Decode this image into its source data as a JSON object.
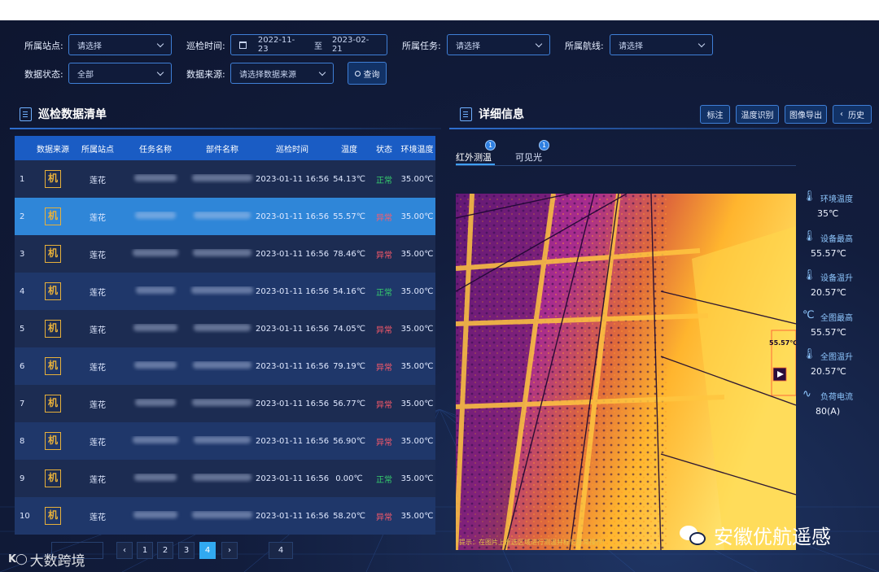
{
  "filters": {
    "station_label": "所属站点:",
    "station_value": "请选择",
    "time_label": "巡检时间:",
    "date_start": "2022-11-23",
    "date_sep": "至",
    "date_end": "2023-02-21",
    "task_label": "所属任务:",
    "task_value": "请选择",
    "route_label": "所属航线:",
    "route_value": "请选择",
    "status_label": "数据状态:",
    "status_value": "全部",
    "source_label": "数据来源:",
    "source_placeholder": "请选择数据来源",
    "query_button": "查询"
  },
  "list": {
    "title": "巡检数据清单",
    "columns": [
      "数据来源",
      "所属站点",
      "任务名称",
      "部件名称",
      "巡检时间",
      "温度",
      "状态",
      "环境温度"
    ],
    "rows": [
      {
        "index": "1",
        "source": "机",
        "station": "莲花",
        "time": "2023-01-11 16:56:...",
        "temp": "54.13℃",
        "status": "正常",
        "env": "35.00℃"
      },
      {
        "index": "2",
        "source": "机",
        "station": "莲花",
        "time": "2023-01-11 16:56:...",
        "temp": "55.57℃",
        "status": "异常",
        "env": "35.00℃"
      },
      {
        "index": "3",
        "source": "机",
        "station": "莲花",
        "time": "2023-01-11 16:56:...",
        "temp": "78.46℃",
        "status": "异常",
        "env": "35.00℃"
      },
      {
        "index": "4",
        "source": "机",
        "station": "莲花",
        "time": "2023-01-11 16:56:...",
        "temp": "54.16℃",
        "status": "正常",
        "env": "35.00℃"
      },
      {
        "index": "5",
        "source": "机",
        "station": "莲花",
        "time": "2023-01-11 16:56:...",
        "temp": "74.05℃",
        "status": "异常",
        "env": "35.00℃"
      },
      {
        "index": "6",
        "source": "机",
        "station": "莲花",
        "time": "2023-01-11 16:56:...",
        "temp": "79.19℃",
        "status": "异常",
        "env": "35.00℃"
      },
      {
        "index": "7",
        "source": "机",
        "station": "莲花",
        "time": "2023-01-11 16:56:...",
        "temp": "56.77℃",
        "status": "异常",
        "env": "35.00℃"
      },
      {
        "index": "8",
        "source": "机",
        "station": "莲花",
        "time": "2023-01-11 16:56:...",
        "temp": "56.90℃",
        "status": "异常",
        "env": "35.00℃"
      },
      {
        "index": "9",
        "source": "机",
        "station": "莲花",
        "time": "2023-01-11 16:56:...",
        "temp": "0.00℃",
        "status": "正常",
        "env": "35.00℃"
      },
      {
        "index": "10",
        "source": "机",
        "station": "莲花",
        "time": "2023-01-11 16:56:...",
        "temp": "58.20℃",
        "status": "异常",
        "env": "35.00℃"
      }
    ],
    "selected_index": "2"
  },
  "pagination": {
    "pages": [
      "1",
      "2",
      "3",
      "4"
    ],
    "current": "4",
    "goto_value": "4"
  },
  "detail": {
    "title": "详细信息",
    "buttons": {
      "mark": "标注",
      "recognize": "温度识别",
      "export": "图像导出",
      "history": "历史"
    },
    "tabs": [
      {
        "label": "红外测温",
        "badge": "1"
      },
      {
        "label": "可见光",
        "badge": "1"
      }
    ],
    "overlay_temp": "55.57℃",
    "hint": "*提示：在图片上框选区域进行测温并标记异常操作!",
    "info": [
      {
        "icon": "thermometer-icon",
        "label": "环境温度",
        "value": "35℃"
      },
      {
        "icon": "thermometer-icon",
        "label": "设备最高",
        "value": "55.57℃"
      },
      {
        "icon": "thermometer-up-icon",
        "label": "设备温升",
        "value": "20.57℃"
      },
      {
        "icon": "celsius-icon",
        "label": "全图最高",
        "value": "55.57℃"
      },
      {
        "icon": "thermometer-up-icon",
        "label": "全图温升",
        "value": "20.57℃"
      },
      {
        "icon": "pulse-icon",
        "label": "负荷电流",
        "value": "80(A)"
      }
    ]
  },
  "watermarks": {
    "bottom_left": "大数跨境",
    "bottom_right": "安徽优航遥感"
  },
  "colors": {
    "accent": "#1a5cc4",
    "selected_row": "#2f86d8",
    "normal": "#36d06d",
    "abnormal": "#ff5a6a",
    "source_icon": "#e7b03a"
  }
}
